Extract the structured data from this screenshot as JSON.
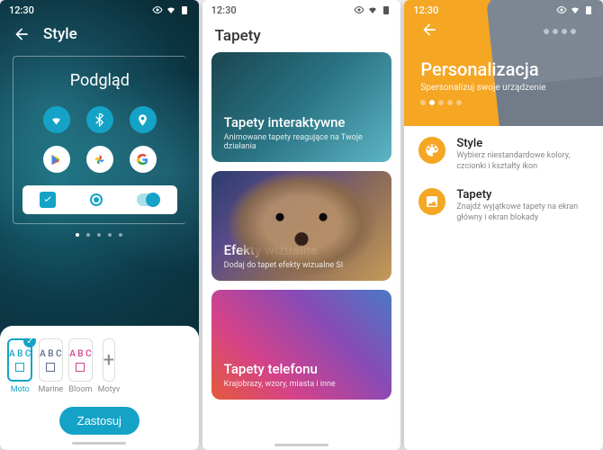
{
  "status_time": "12:30",
  "phone1": {
    "title": "Style",
    "preview_label": "Podgląd",
    "themes": [
      {
        "name": "Moto",
        "color": "#14a3c7"
      },
      {
        "name": "Marine",
        "color": "#5a6b8a"
      },
      {
        "name": "Bloom",
        "color": "#d4428a"
      },
      {
        "name": "Motyv",
        "color": "#888"
      }
    ],
    "apply_label": "Zastosuj"
  },
  "phone2": {
    "title": "Tapety",
    "cards": [
      {
        "title": "Tapety interaktywne",
        "subtitle": "Animowane tapety reagujące na Twoje działania"
      },
      {
        "title": "Efekty wizualne",
        "subtitle": "Dodaj do tapet efekty wizualne SI"
      },
      {
        "title": "Tapety telefonu",
        "subtitle": "Krajobrazy, wzory, miasta i inne"
      }
    ]
  },
  "phone3": {
    "hero_title": "Personalizacja",
    "hero_subtitle": "Spersonalizuj swoje urządzenie",
    "items": [
      {
        "title": "Style",
        "subtitle": "Wybierz niestandardowe kolory, czcionki i kształty ikon"
      },
      {
        "title": "Tapety",
        "subtitle": "Znajdź wyjątkowe tapety na ekran główny i ekran blokady"
      }
    ]
  }
}
